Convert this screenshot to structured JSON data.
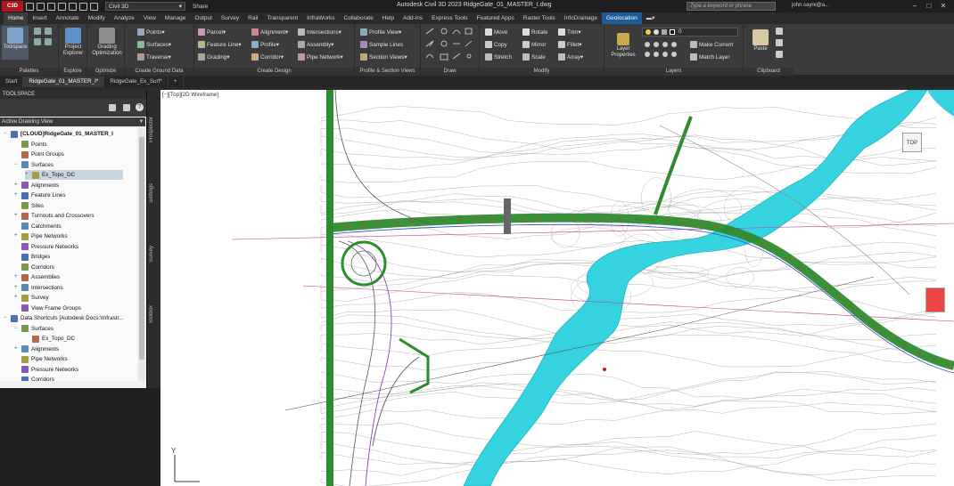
{
  "titlebar": {
    "logo": "C3D",
    "workspace": "Civil 3D",
    "share": "Share",
    "title": "Autodesk Civil 3D 2023    RidgeGate_01_MASTER_I.dwg",
    "search_placeholder": "Type a keyword or phrase",
    "user": "john.sayre@a..."
  },
  "ribbon_tabs": [
    "Home",
    "Insert",
    "Annotate",
    "Modify",
    "Analyze",
    "View",
    "Manage",
    "Output",
    "Survey",
    "Rail",
    "Transparent",
    "InfraWorks",
    "Collaborate",
    "Help",
    "Add-ins",
    "Express Tools",
    "Featured Apps",
    "Raster Tools",
    "InfoDrainage",
    "Geolocation"
  ],
  "ribbon": {
    "palettes": {
      "title": "Palettes",
      "toolspace": "Toolspace"
    },
    "explore": {
      "title": "Explore",
      "project_explorer": "Project Explorer"
    },
    "optimize": {
      "title": "Optimize",
      "grading_optimization": "Grading Optimization"
    },
    "ground": {
      "title": "Create Ground Data",
      "points": "Points",
      "surfaces": "Surfaces",
      "traverse": "Traverse"
    },
    "design": {
      "title": "Create Design",
      "parcel": "Parcel",
      "feature_line": "Feature Line",
      "grading": "Grading",
      "alignment": "Alignment",
      "profile": "Profile",
      "corridor": "Corridor",
      "intersections": "Intersections",
      "assembly": "Assembly",
      "pipe_network": "Pipe Network"
    },
    "profile_views": {
      "title": "Profile & Section Views",
      "profile_view": "Profile View",
      "sample_lines": "Sample Lines",
      "section_views": "Section Views"
    },
    "draw": {
      "title": "Draw"
    },
    "modify": {
      "title": "Modify",
      "move": "Move",
      "copy": "Copy",
      "stretch": "Stretch",
      "rotate": "Rotate",
      "mirror": "Mirror",
      "scale": "Scale",
      "trim": "Trim",
      "fillet": "Fillet",
      "array": "Array"
    },
    "layers": {
      "title": "Layers",
      "layer_properties": "Layer Properties",
      "layer_value": "0",
      "make_current": "Make Current",
      "match_layer": "Match Layer"
    },
    "clipboard": {
      "title": "Clipboard",
      "paste": "Paste"
    }
  },
  "doc_tabs": [
    "Start",
    "RidgeGate_01_MASTER_I*",
    "RidgeGate_Ex_Surf*"
  ],
  "toolspace": {
    "header": "TOOLSPACE",
    "view": "Active Drawing View",
    "side_tabs": [
      "Prospector",
      "Settings",
      "Survey",
      "Toolbox"
    ],
    "tree": [
      {
        "label": "[CLOUD]RidgeGate_01_MASTER_I",
        "level": 0,
        "exp": "−"
      },
      {
        "label": "Points",
        "level": 1,
        "exp": ""
      },
      {
        "label": "Point Groups",
        "level": 1,
        "exp": ""
      },
      {
        "label": "Surfaces",
        "level": 1,
        "exp": "−"
      },
      {
        "label": "Ex_Topo_DC",
        "level": 2,
        "exp": "+"
      },
      {
        "label": "Alignments",
        "level": 1,
        "exp": "+"
      },
      {
        "label": "Feature Lines",
        "level": 1,
        "exp": "+"
      },
      {
        "label": "Sites",
        "level": 1,
        "exp": ""
      },
      {
        "label": "Turnouts and Crossovers",
        "level": 1,
        "exp": "+"
      },
      {
        "label": "Catchments",
        "level": 1,
        "exp": ""
      },
      {
        "label": "Pipe Networks",
        "level": 1,
        "exp": "+"
      },
      {
        "label": "Pressure Networks",
        "level": 1,
        "exp": ""
      },
      {
        "label": "Bridges",
        "level": 1,
        "exp": ""
      },
      {
        "label": "Corridors",
        "level": 1,
        "exp": ""
      },
      {
        "label": "Assemblies",
        "level": 1,
        "exp": "+"
      },
      {
        "label": "Intersections",
        "level": 1,
        "exp": "+"
      },
      {
        "label": "Survey",
        "level": 1,
        "exp": "+"
      },
      {
        "label": "View Frame Groups",
        "level": 1,
        "exp": ""
      },
      {
        "label": "Data Shortcuts [Autodesk Docs:\\Infrastr...",
        "level": 0,
        "exp": "−"
      },
      {
        "label": "Surfaces",
        "level": 1,
        "exp": "−"
      },
      {
        "label": "Ex_Topo_DC",
        "level": 2,
        "exp": ""
      },
      {
        "label": "Alignments",
        "level": 1,
        "exp": "+"
      },
      {
        "label": "Pipe Networks",
        "level": 1,
        "exp": ""
      },
      {
        "label": "Pressure Networks",
        "level": 1,
        "exp": ""
      },
      {
        "label": "Corridors",
        "level": 1,
        "exp": ""
      }
    ]
  },
  "viewport": {
    "label": "[−][Top][2D Wireframe]",
    "viewcube": "TOP",
    "ucs_y": "Y",
    "ucs_x": "X"
  },
  "colors": {
    "water": "#35d3e0",
    "road_green": "#2e8b2e",
    "contour": "#8a8a8a",
    "magenta": "#c23b9c",
    "accent": "#1c5d99"
  }
}
